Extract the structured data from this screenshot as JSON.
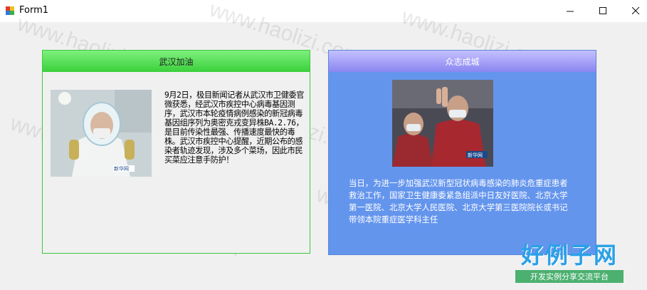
{
  "window": {
    "title": "Form1",
    "minimize": "—",
    "maximize": "☐",
    "close": "✕"
  },
  "left_panel": {
    "title": "武汉加油",
    "text": "9月2日，极目新闻记者从武汉市卫健委官微获悉，经武汉市疾控中心病毒基因测序，武汉市本轮疫情病例感染的新冠病毒基因组序列为奥密克戎变异株BA.2.76，是目前传染性最强、传播速度最快的毒株。武汉市疾控中心提醒，近期公布的感染者轨迹发现，涉及多个菜场，因此市民买菜应注意手防护！",
    "image_caption": "新华网"
  },
  "right_panel": {
    "title": "众志成城",
    "text": "当日，为进一步加强武汉新型冠状病毒感染的肺炎危重症患者救治工作，国家卫生健康委紧急组派中日友好医院、北京大学第一医院、北京大学人民医院、北京大学第三医院院长或书记带领本院重症医学科主任",
    "image_caption": "新华网"
  },
  "watermark": "www.haolizi.com",
  "logo": {
    "main": "好例子网",
    "sub": "开发实例分享交流平台"
  }
}
